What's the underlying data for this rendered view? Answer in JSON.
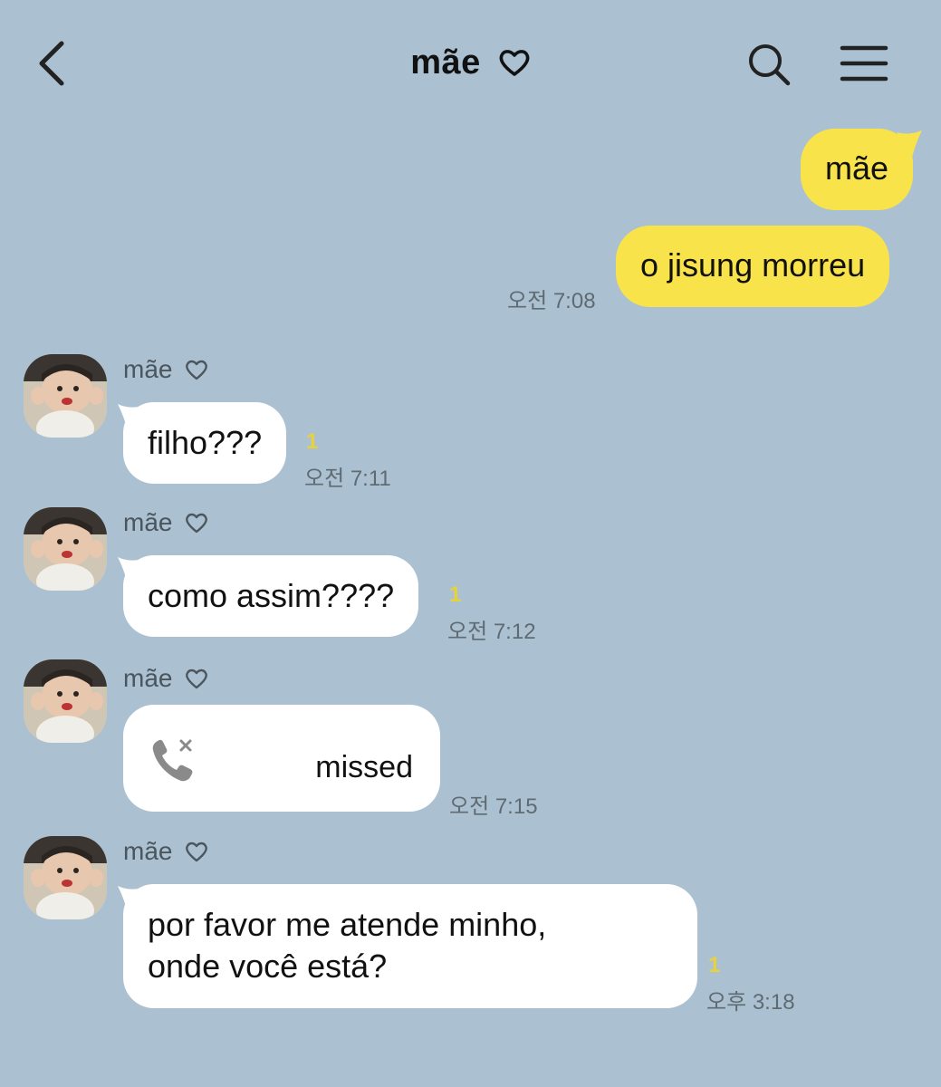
{
  "header": {
    "title": "mãe",
    "back_icon": "chevron-left-icon",
    "search_icon": "search-icon",
    "menu_icon": "hamburger-menu-icon"
  },
  "colors": {
    "background": "#abc1d1",
    "my_bubble": "#f9e34b",
    "their_bubble": "#ffffff",
    "unread": "#e8d23c"
  },
  "outgoing": {
    "msg1": "mãe",
    "msg2": "o jisung morreu",
    "time": "오전 7:08"
  },
  "incoming": [
    {
      "sender": "mãe",
      "text": "filho???",
      "unread": "1",
      "time": "오전 7:11"
    },
    {
      "sender": "mãe",
      "text": "como assim????",
      "unread": "1",
      "time": "오전 7:12"
    },
    {
      "sender": "mãe",
      "call_status": "missed",
      "call_icon": "missed-call-icon",
      "time": "오전 7:15"
    },
    {
      "sender": "mãe",
      "line1": "por favor me atende minho,",
      "line2": "onde você está?",
      "unread": "1",
      "time": "오후 3:18"
    }
  ]
}
